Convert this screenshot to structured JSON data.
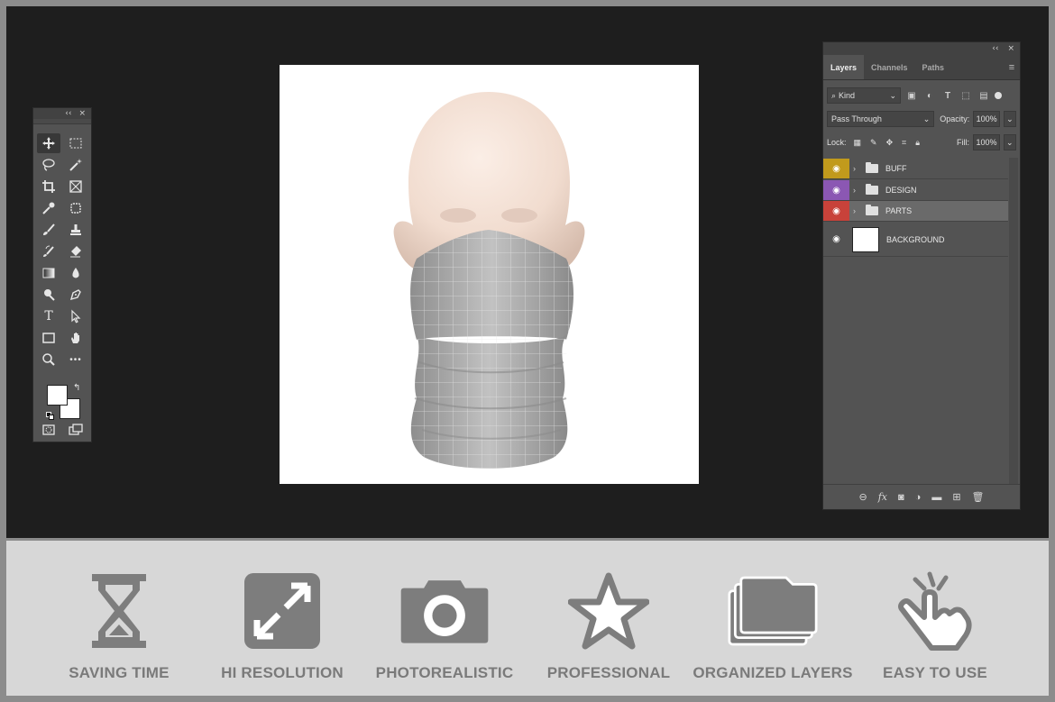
{
  "tools_panel": {
    "collapse_label": "‹‹",
    "close_label": "×",
    "type_tool_label": "T",
    "more_label": "•••"
  },
  "layers_panel": {
    "collapse_label": "‹‹",
    "close_label": "×",
    "tabs": [
      "Layers",
      "Channels",
      "Paths"
    ],
    "filter": {
      "kind_label": "Kind"
    },
    "blend_mode": "Pass Through",
    "opacity_label": "Opacity:",
    "opacity_value": "100%",
    "lock_label": "Lock:",
    "fill_label": "Fill:",
    "fill_value": "100%",
    "layers": [
      {
        "name": "BUFF",
        "color": "#c19a1c",
        "type": "group"
      },
      {
        "name": "DESIGN",
        "color": "#8b57b3",
        "type": "group"
      },
      {
        "name": "PARTS",
        "color": "#c8423a",
        "type": "group",
        "selected": true
      },
      {
        "name": "BACKGROUND",
        "type": "layer"
      }
    ]
  },
  "features": [
    {
      "label": "SAVING TIME",
      "icon": "hourglass-icon"
    },
    {
      "label": "HI RESOLUTION",
      "icon": "expand-icon"
    },
    {
      "label": "PHOTOREALISTIC",
      "icon": "camera-icon"
    },
    {
      "label": "PROFESSIONAL",
      "icon": "star-icon"
    },
    {
      "label": "ORGANIZED LAYERS",
      "icon": "layers-folder-icon"
    },
    {
      "label": "EASY TO USE",
      "icon": "tap-hand-icon"
    }
  ],
  "colors": {
    "workspace": "#1e1e1e",
    "panel": "#535353",
    "feature_band": "#d7d7d7",
    "feature_icon": "#7d7d7d"
  }
}
